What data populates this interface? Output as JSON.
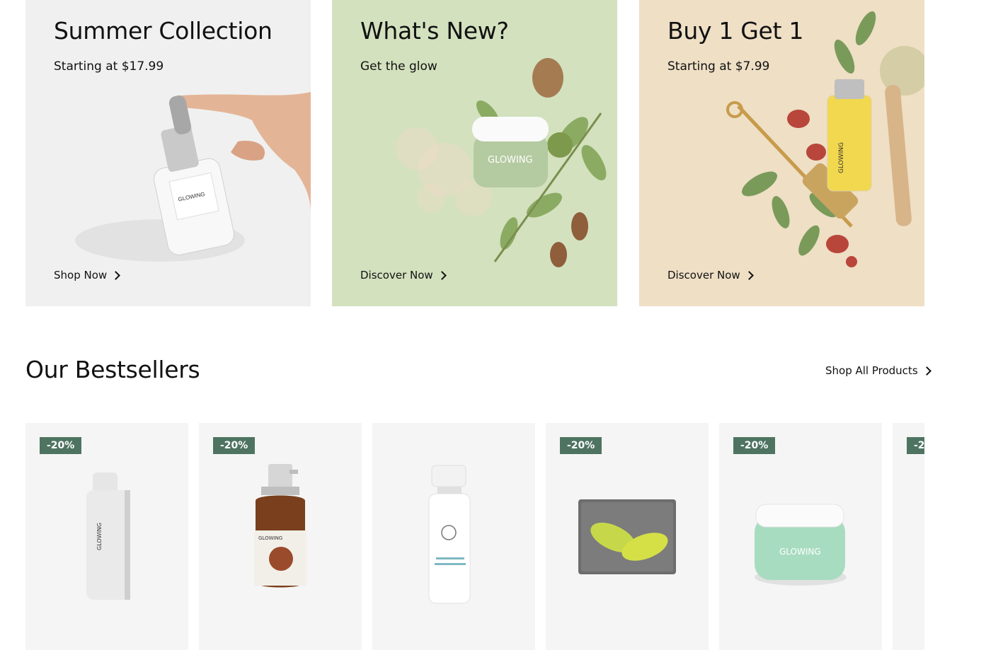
{
  "promos": [
    {
      "title": "Summer Collection",
      "subtitle": "Starting at $17.99",
      "cta": "Shop Now",
      "bg": "#f0f0f0"
    },
    {
      "title": "What's New?",
      "subtitle": "Get the glow",
      "cta": "Discover Now",
      "bg": "#d3e1be"
    },
    {
      "title": "Buy 1 Get 1",
      "subtitle": "Starting at $7.99",
      "cta": "Discover Now",
      "bg": "#eedfc5"
    }
  ],
  "brand_label": "GLOWING",
  "bestsellers": {
    "title": "Our Bestsellers",
    "shop_all": "Shop All Products",
    "products": [
      {
        "badge": "-20%"
      },
      {
        "badge": "-20%"
      },
      {
        "badge": ""
      },
      {
        "badge": "-20%"
      },
      {
        "badge": "-20%"
      },
      {
        "badge": "-2"
      }
    ]
  },
  "colors": {
    "badge": "#4e7461",
    "card_bg": "#f5f5f5"
  },
  "icons": {
    "cta": "chevron-right-icon"
  }
}
